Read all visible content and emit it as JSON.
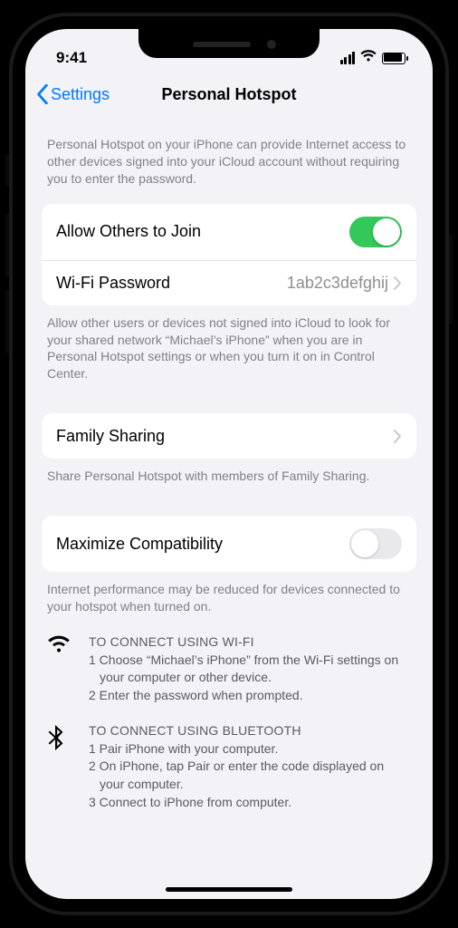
{
  "status": {
    "time": "9:41"
  },
  "nav": {
    "back": "Settings",
    "title": "Personal Hotspot"
  },
  "intro": "Personal Hotspot on your iPhone can provide Internet access to other devices signed into your iCloud account without requiring you to enter the password.",
  "group1": {
    "allow": {
      "label": "Allow Others to Join",
      "on": true
    },
    "wifi": {
      "label": "Wi-Fi Password",
      "value": "1ab2c3defghij"
    }
  },
  "footer1": "Allow other users or devices not signed into iCloud to look for your shared network “Michael’s iPhone” when you are in Personal Hotspot settings or when you turn it on in Control Center.",
  "group2": {
    "family": {
      "label": "Family Sharing"
    }
  },
  "footer2": "Share Personal Hotspot with members of Family Sharing.",
  "group3": {
    "compat": {
      "label": "Maximize Compatibility",
      "on": false
    }
  },
  "footer3": "Internet performance may be reduced for devices connected to your hotspot when turned on.",
  "connect": {
    "wifi": {
      "heading": "TO CONNECT USING WI-FI",
      "steps": [
        "1 Choose “Michael’s iPhone” from the Wi-Fi settings on your computer or other device.",
        "2 Enter the password when prompted."
      ]
    },
    "bt": {
      "heading": "TO CONNECT USING BLUETOOTH",
      "steps": [
        "1 Pair iPhone with your computer.",
        "2 On iPhone, tap Pair or enter the code displayed on your computer.",
        "3 Connect to iPhone from computer."
      ]
    }
  }
}
